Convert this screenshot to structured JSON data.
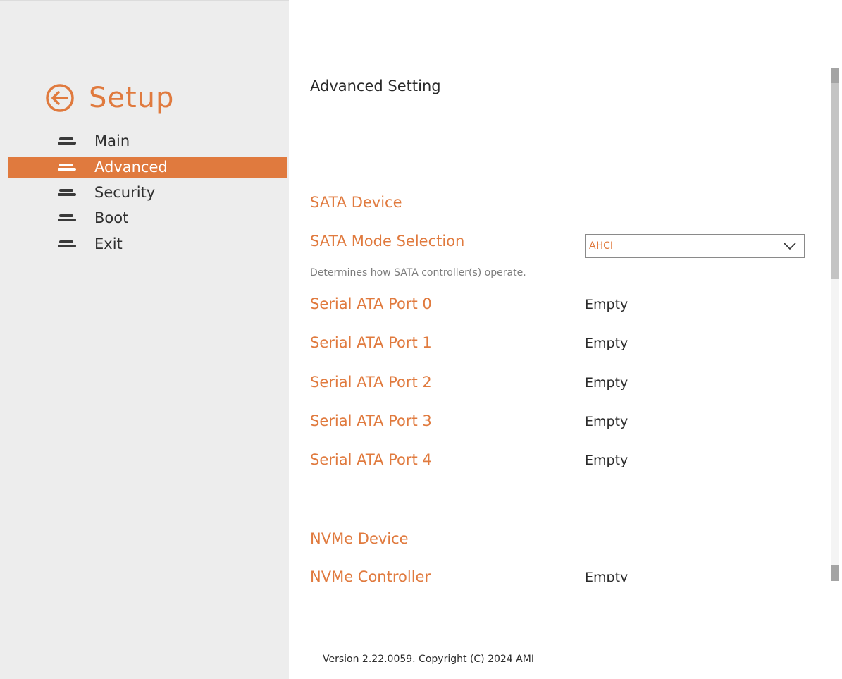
{
  "sidebar": {
    "title": "Setup",
    "back_icon": "circle-arrow-left-icon",
    "accent": "#e07a3e",
    "items": [
      {
        "label": "Main",
        "icon": "menu-bars-icon",
        "active": false
      },
      {
        "label": "Advanced",
        "icon": "menu-bars-icon",
        "active": true
      },
      {
        "label": "Security",
        "icon": "menu-bars-icon",
        "active": false
      },
      {
        "label": "Boot",
        "icon": "menu-bars-icon",
        "active": false
      },
      {
        "label": "Exit",
        "icon": "menu-bars-icon",
        "active": false
      }
    ]
  },
  "main": {
    "title": "Advanced Setting",
    "sata": {
      "section_title": "SATA Device",
      "mode_label": "SATA Mode Selection",
      "mode_value": "AHCI",
      "mode_help": "Determines how SATA controller(s) operate.",
      "ports": [
        {
          "label": "Serial ATA Port 0",
          "value": "Empty"
        },
        {
          "label": "Serial ATA Port 1",
          "value": "Empty"
        },
        {
          "label": "Serial ATA Port 2",
          "value": "Empty"
        },
        {
          "label": "Serial ATA Port 3",
          "value": "Empty"
        },
        {
          "label": "Serial ATA Port 4",
          "value": "Empty"
        }
      ]
    },
    "nvme": {
      "section_title": "NVMe Device",
      "controller_label": "NVMe Controller",
      "controller_value": "Empty"
    }
  },
  "footer": {
    "version": "Version 2.22.0059. Copyright (C) 2024 AMI"
  }
}
